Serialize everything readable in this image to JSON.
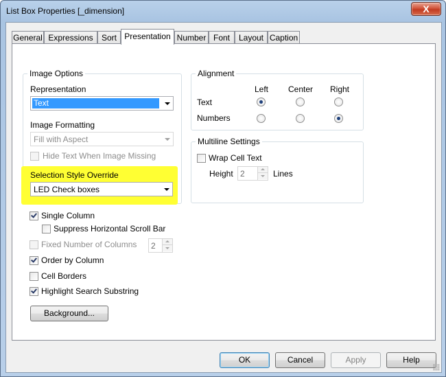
{
  "window": {
    "title": "List Box Properties [_dimension]",
    "close_label": "X"
  },
  "tabs": [
    {
      "label": "General"
    },
    {
      "label": "Expressions"
    },
    {
      "label": "Sort"
    },
    {
      "label": "Presentation"
    },
    {
      "label": "Number"
    },
    {
      "label": "Font"
    },
    {
      "label": "Layout"
    },
    {
      "label": "Caption"
    }
  ],
  "active_tab": "Presentation",
  "image_options": {
    "title": "Image Options",
    "representation_label": "Representation",
    "representation_value": "Text",
    "image_formatting_label": "Image Formatting",
    "image_formatting_value": "Fill with Aspect",
    "hide_text_label": "Hide Text When Image Missing",
    "hide_text_checked": false,
    "selection_style_label": "Selection Style Override",
    "selection_style_value": "LED Check boxes",
    "highlight_color": "#ffff33"
  },
  "options": {
    "single_column": {
      "label": "Single Column",
      "checked": true
    },
    "suppress_hscroll": {
      "label": "Suppress Horizontal Scroll Bar",
      "checked": false
    },
    "fixed_columns": {
      "label": "Fixed Number of Columns",
      "checked": false,
      "value": "2"
    },
    "order_by_column": {
      "label": "Order by Column",
      "checked": true
    },
    "cell_borders": {
      "label": "Cell Borders",
      "checked": false
    },
    "highlight_search": {
      "label": "Highlight Search Substring",
      "checked": true
    },
    "background_button": "Background..."
  },
  "alignment": {
    "title": "Alignment",
    "col_left": "Left",
    "col_center": "Center",
    "col_right": "Right",
    "row_text": "Text",
    "row_numbers": "Numbers",
    "text_selected": "Left",
    "numbers_selected": "Right"
  },
  "multiline": {
    "title": "Multiline Settings",
    "wrap_label": "Wrap Cell Text",
    "wrap_checked": false,
    "height_label": "Height",
    "height_value": "2",
    "lines_label": "Lines"
  },
  "footer": {
    "ok": "OK",
    "cancel": "Cancel",
    "apply": "Apply",
    "help": "Help"
  }
}
